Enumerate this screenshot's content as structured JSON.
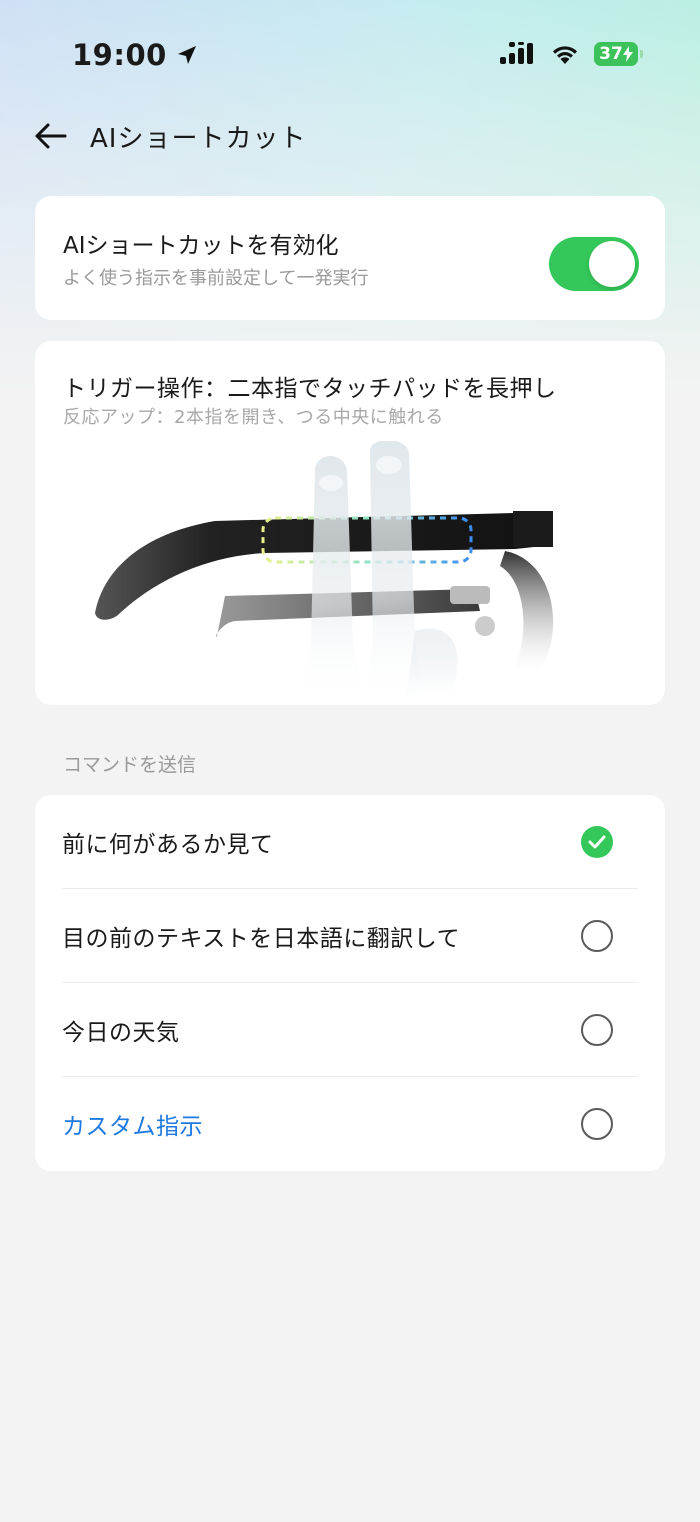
{
  "status_bar": {
    "time": "19:00",
    "battery": "37"
  },
  "header": {
    "title": "AIショートカット"
  },
  "enable_card": {
    "title": "AIショートカットを有効化",
    "subtitle": "よく使う指示を事前設定して一発実行",
    "enabled": true
  },
  "trigger_card": {
    "title": "トリガー操作：二本指でタッチパッドを長押し",
    "subtitle": "反応アップ：2本指を開き、つる中央に触れる"
  },
  "commands": {
    "section_label": "コマンドを送信",
    "items": [
      {
        "label": "前に何があるか見て",
        "selected": true
      },
      {
        "label": "目の前のテキストを日本語に翻訳して",
        "selected": false
      },
      {
        "label": "今日の天気",
        "selected": false
      },
      {
        "label": "カスタム指示",
        "selected": false
      }
    ]
  },
  "colors": {
    "accent_green": "#34c759",
    "link_blue": "#1f7ae0"
  }
}
